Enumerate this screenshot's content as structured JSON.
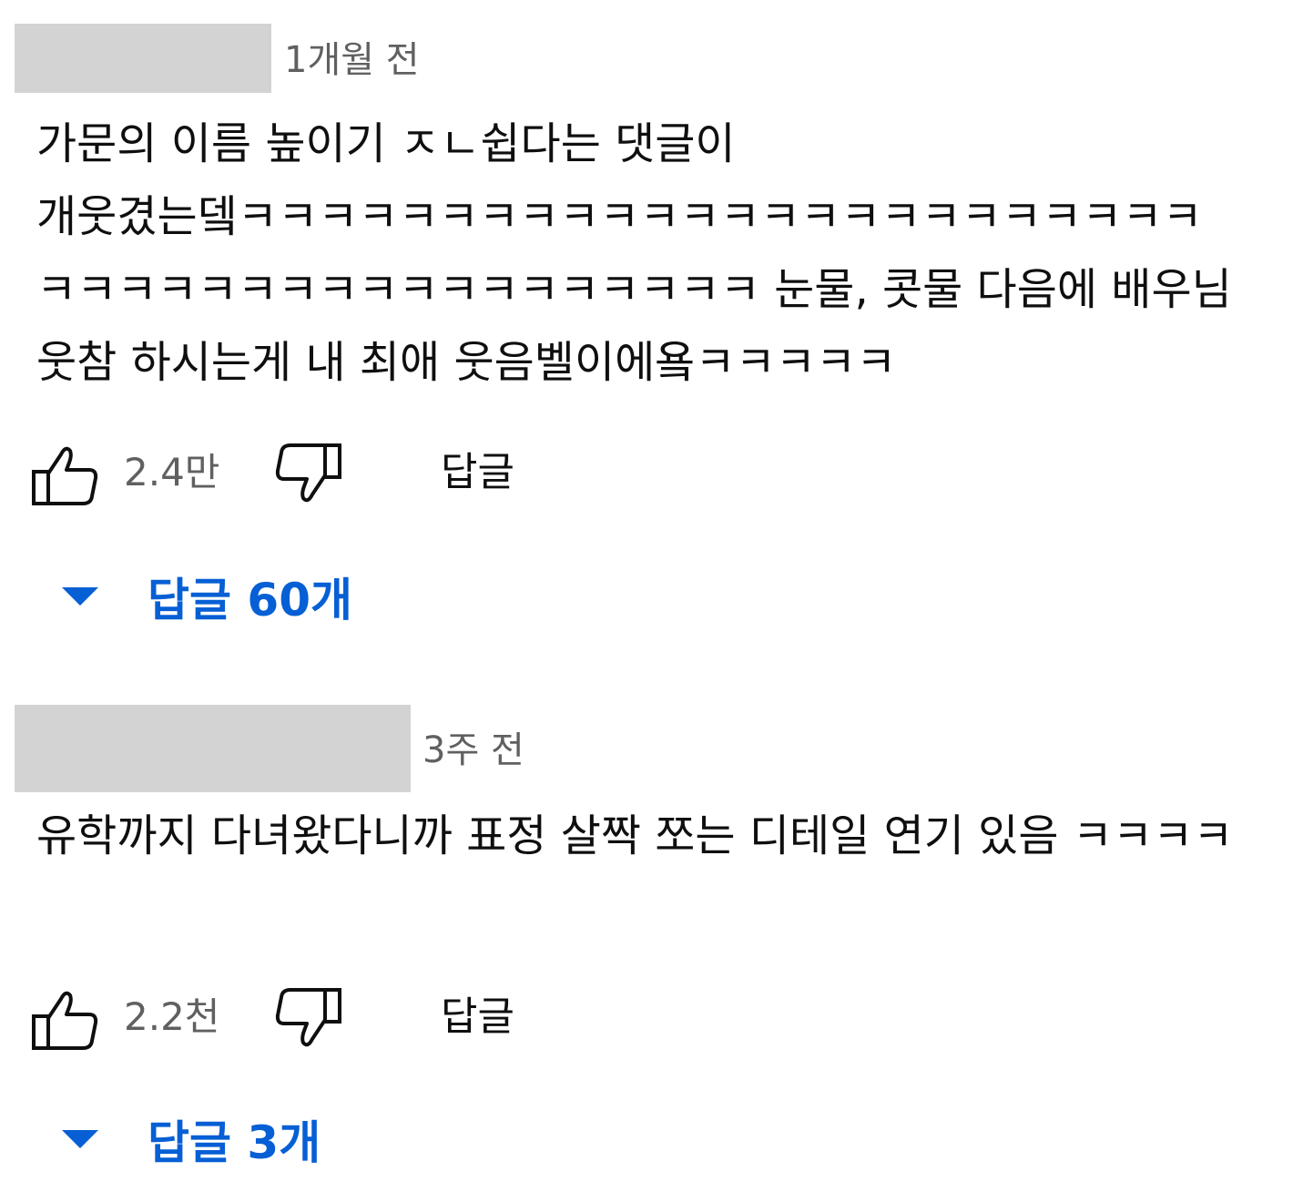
{
  "comments": [
    {
      "time": "1개월 전",
      "text": "가문의 이름 높이기 ㅈㄴ쉽다는 댓글이 개웃겼는뎈ㅋㅋㅋㅋㅋㅋㅋㅋㅋㅋㅋㅋㅋㅋㅋㅋㅋㅋㅋㅋㅋㅋㅋㅋㅋㅋㅋㅋㅋㅋㅋㅋㅋㅋㅋㅋㅋㅋㅋㅋㅋㅋ 눈물, 콧물 다음에 배우님 웃참 하시는게 내 최애 웃음벨이에욬ㅋㅋㅋㅋㅋ",
      "likes": "2.4만",
      "reply_label": "답글",
      "replies_toggle": "답글 60개"
    },
    {
      "time": "3주 전",
      "text": "유학까지 다녀왔다니까 표정 살짝 쪼는 디테일 연기 있음 ㅋㅋㅋㅋ",
      "likes": "2.2천",
      "reply_label": "답글",
      "replies_toggle": "답글 3개"
    }
  ],
  "icons": {
    "like": "thumbs-up-icon",
    "dislike": "thumbs-down-icon",
    "expand": "caret-down-icon"
  },
  "colors": {
    "link": "#065fd4",
    "meta": "#606060",
    "redaction": "#d3d3d3",
    "text": "#0f0f0f"
  }
}
